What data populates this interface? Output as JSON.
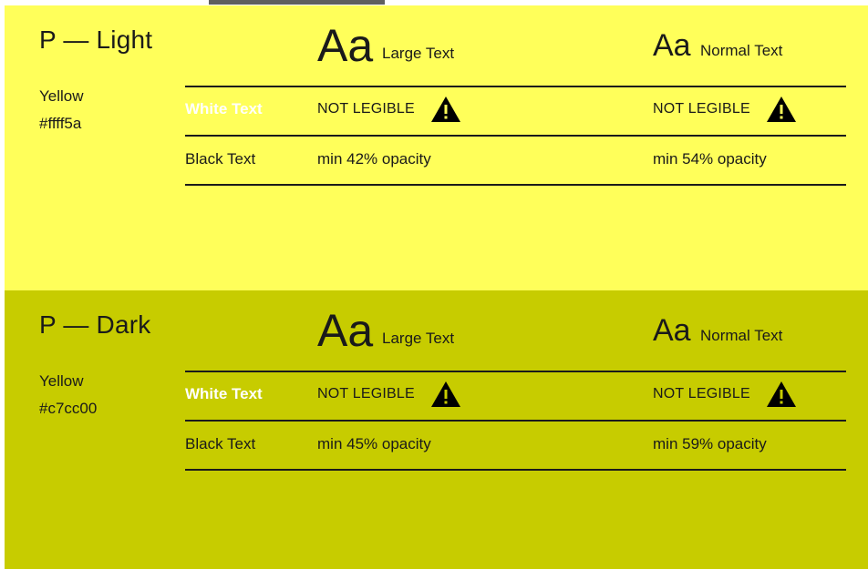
{
  "colors": {
    "light_bg": "#ffff5a",
    "dark_bg": "#c7cc00",
    "text": "#1a1a1a",
    "white_text": "#ffffff"
  },
  "light": {
    "title": "P — Light",
    "color_name": "Yellow",
    "hex": "#ffff5a",
    "large_sample": "Aa",
    "large_label": "Large Text",
    "normal_sample": "Aa",
    "normal_label": "Normal Text",
    "white_label": "White Text",
    "white_large": "NOT LEGIBLE",
    "white_normal": "NOT LEGIBLE",
    "black_label": "Black Text",
    "black_large": "min 42% opacity",
    "black_normal": "min 54% opacity"
  },
  "dark": {
    "title": "P — Dark",
    "color_name": "Yellow",
    "hex": "#c7cc00",
    "large_sample": "Aa",
    "large_label": "Large Text",
    "normal_sample": "Aa",
    "normal_label": "Normal Text",
    "white_label": "White Text",
    "white_large": "NOT LEGIBLE",
    "white_normal": "NOT LEGIBLE",
    "black_label": "Black Text",
    "black_large": "min 45% opacity",
    "black_normal": "min 59% opacity"
  }
}
